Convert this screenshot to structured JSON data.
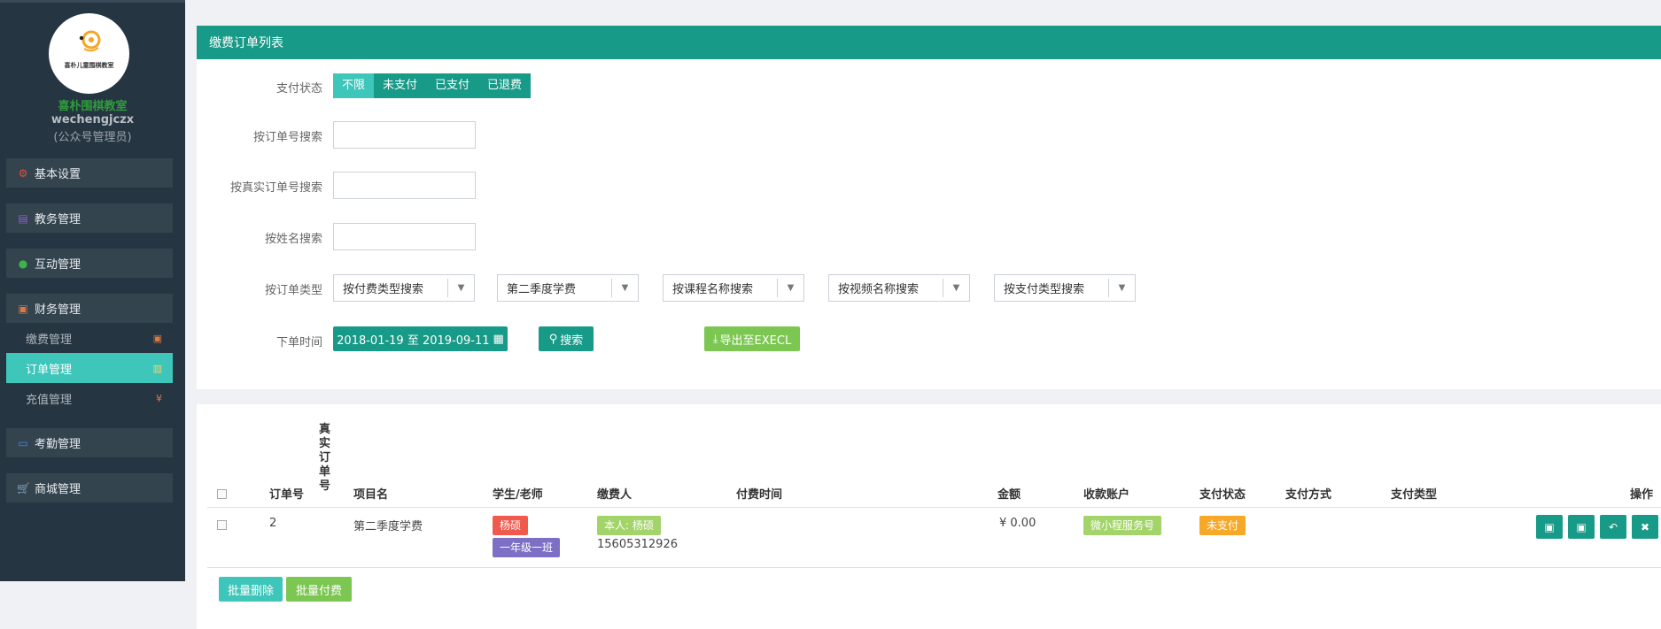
{
  "sidebar": {
    "logo_text": "喜朴儿童围棋教室",
    "school_name": "喜朴围棋教室",
    "account": "wechengjczx",
    "role": "(公众号管理员)",
    "menu": [
      {
        "label": "基本设置",
        "icon": "gear-icon"
      },
      {
        "label": "教务管理",
        "icon": "database-icon"
      },
      {
        "label": "互动管理",
        "icon": "chat-icon"
      },
      {
        "label": "财务管理",
        "icon": "money-icon"
      },
      {
        "label": "考勤管理",
        "icon": "card-icon"
      },
      {
        "label": "商城管理",
        "icon": "cart-icon"
      }
    ],
    "finance_sub": [
      {
        "label": "缴费管理",
        "icon": "money-icon"
      },
      {
        "label": "订单管理",
        "icon": "bar-chart-icon"
      },
      {
        "label": "充值管理",
        "icon": "yen-icon"
      }
    ],
    "colors": {
      "bg": "#263542",
      "active": "#3fc6ba"
    }
  },
  "panel": {
    "title": "缴费订单列表",
    "pay_status_label": "支付状态",
    "pay_status_options": [
      "不限",
      "未支付",
      "已支付",
      "已退费"
    ],
    "order_no_label": "按订单号搜索",
    "real_order_no_label": "按真实订单号搜索",
    "name_label": "按姓名搜索",
    "order_type_label": "按订单类型",
    "selects": [
      "按付费类型搜索",
      "第二季度学费",
      "按课程名称搜索",
      "按视频名称搜索",
      "按支付类型搜索"
    ],
    "time_label": "下单时间",
    "date_range": "2018-01-19 至 2019-09-11",
    "search_btn": "搜索",
    "export_btn": "导出至EXECL"
  },
  "table": {
    "headers": {
      "order_no": "订单号",
      "real_order_no": [
        "真",
        "实",
        "订",
        "单",
        "号"
      ],
      "project": "项目名",
      "student": "学生/老师",
      "payer": "缴费人",
      "pay_time": "付费时间",
      "amount": "金额",
      "account": "收款账户",
      "status": "支付状态",
      "method": "支付方式",
      "type": "支付类型",
      "action": "操作"
    },
    "rows": [
      {
        "order_no": "2",
        "project": "第二季度学费",
        "student_tag": "杨硕",
        "class_tag": "一年级一班",
        "payer_tag": "本人: 杨硕",
        "payer_phone": "15605312926",
        "amount": "¥ 0.00",
        "account_tag": "微小程服务号",
        "status_tag": "未支付"
      }
    ],
    "batch_delete": "批量删除",
    "batch_pay": "批量付费"
  }
}
